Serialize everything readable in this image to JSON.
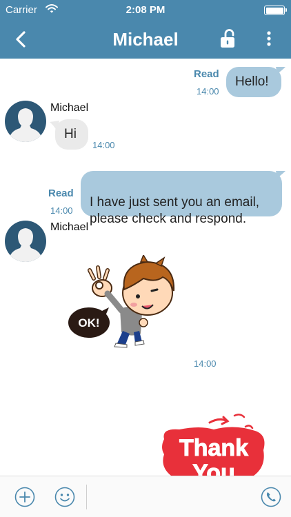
{
  "status_bar": {
    "carrier": "Carrier",
    "time": "2:08 PM",
    "battery_level": 1.0,
    "wifi_icon": "wifi-icon",
    "battery_icon": "battery-icon"
  },
  "nav": {
    "title": "Michael",
    "back_icon": "chevron-left-icon",
    "lock_icon": "unlocked-padlock-icon",
    "more_icon": "vertical-ellipsis-icon"
  },
  "messages": [
    {
      "direction": "out",
      "text": "Hello!",
      "status": "Read",
      "time": "14:00"
    },
    {
      "direction": "in",
      "sender": "Michael",
      "text": "Hi",
      "time": "14:00"
    },
    {
      "direction": "out",
      "text": "I have just sent you an email,\nplease check and respond.",
      "status": "Read",
      "time": "14:00"
    },
    {
      "direction": "in",
      "sender": "Michael",
      "sticker": "ok-sticker",
      "sticker_text": "OK!",
      "time": "14:00"
    },
    {
      "direction": "out",
      "sticker": "thank-you-sticker",
      "sticker_text": "Thank You"
    }
  ],
  "input_bar": {
    "add_icon": "plus-circle-icon",
    "emoji_icon": "smiley-icon",
    "call_icon": "phone-icon",
    "placeholder": ""
  },
  "colors": {
    "accent": "#4a88ad",
    "outgoing_bubble": "#a9c9dd",
    "incoming_bubble": "#eaeaea",
    "sticker_red": "#e8303a"
  }
}
